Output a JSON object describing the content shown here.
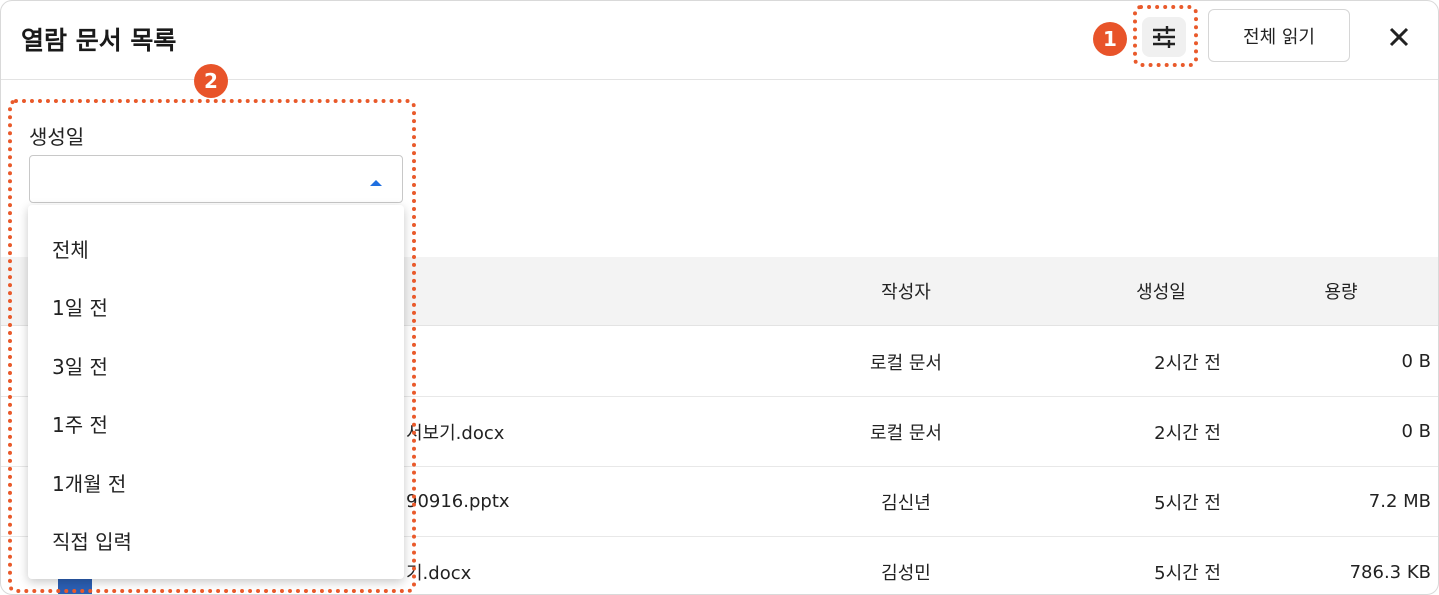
{
  "header": {
    "title": "열람 문서 목록",
    "read_all_label": "전체 읽기",
    "filter_icon": "sliders-icon",
    "close_icon": "close-icon"
  },
  "filter": {
    "label": "생성일",
    "selected_value": "",
    "options": [
      "전체",
      "1일 전",
      "3일 전",
      "1주 전",
      "1개월 전",
      "직접 입력"
    ]
  },
  "table": {
    "columns": [
      "작성자",
      "생성일",
      "용량"
    ],
    "rows": [
      {
        "name": "",
        "author": "로컬 문서",
        "created": "2시간 전",
        "size": "0 B"
      },
      {
        "name": "서보기.docx",
        "author": "로컬 문서",
        "created": "2시간 전",
        "size": "0 B"
      },
      {
        "name": "90916.pptx",
        "author": "김신년",
        "created": "5시간 전",
        "size": "7.2 MB"
      },
      {
        "name": "기.docx",
        "author": "김성민",
        "created": "5시간 전",
        "size": "786.3 KB"
      }
    ]
  },
  "callouts": [
    "1",
    "2"
  ],
  "colors": {
    "callout": "#e8542a",
    "caret": "#1f6fe0"
  }
}
